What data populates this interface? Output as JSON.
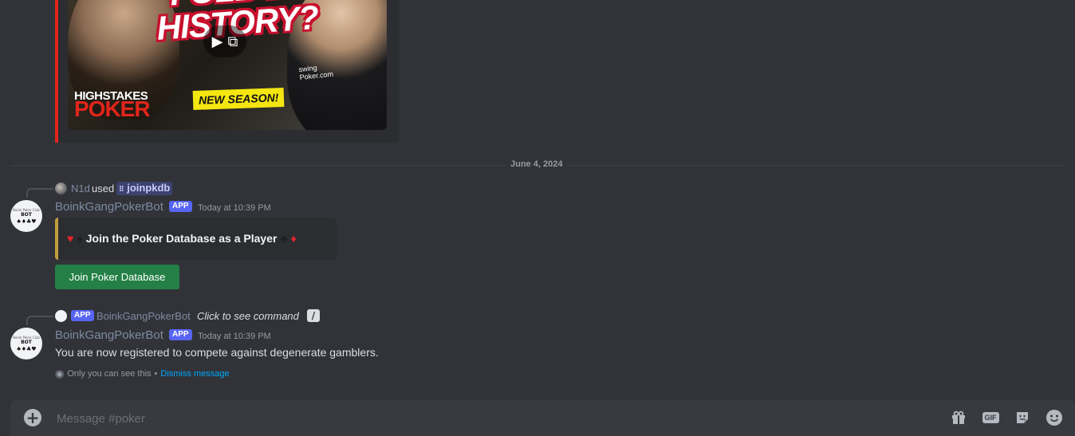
{
  "video_embed": {
    "thumbnail_title": "FOLD IN HISTORY?",
    "brand_line1": "HIGHSTAKES",
    "brand_line2": "POKER",
    "badge": "NEW SEASON!",
    "site_text": "swing\nPoker.com",
    "accent_color": "#e1251b"
  },
  "divider": {
    "label": "June 4, 2024"
  },
  "message1": {
    "reply": {
      "user": "N1d",
      "used_word": "used",
      "command": "joinpkdb"
    },
    "author": "BoinkGangPokerBot",
    "badge": "APP",
    "timestamp": "Today at 10:39 PM",
    "avatar": {
      "line1": "Boink Poker Club",
      "line2": "BOT",
      "line3": "♠♦♣♥"
    },
    "embed": {
      "title": "Join the Poker Database as a Player",
      "bar_color": "#c09d3c"
    },
    "button": {
      "label": "Join Poker Database",
      "color": "#248046"
    }
  },
  "message2": {
    "reply": {
      "badge": "APP",
      "user": "BoinkGangPokerBot",
      "hint": "Click to see command"
    },
    "author": "BoinkGangPokerBot",
    "badge": "APP",
    "timestamp": "Today at 10:39 PM",
    "avatar": {
      "line1": "Boink Poker Club",
      "line2": "BOT",
      "line3": "♠♦♣♥"
    },
    "text": "You are now registered to compete against degenerate gamblers.",
    "ephemeral": {
      "notice": "Only you can see this",
      "separator": "•",
      "dismiss": "Dismiss message"
    }
  },
  "composer": {
    "placeholder": "Message #poker",
    "tools": [
      "gift-icon",
      "gif-icon",
      "sticker-icon",
      "emoji-icon"
    ],
    "gif_label": "GIF"
  }
}
